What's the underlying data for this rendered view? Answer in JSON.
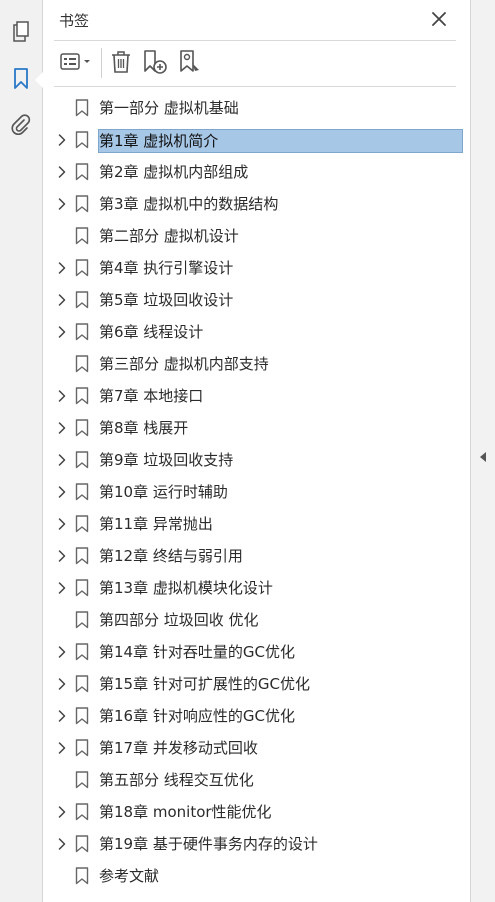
{
  "panel": {
    "title": "书签"
  },
  "rail": {
    "items": [
      {
        "icon": "pages-icon"
      },
      {
        "icon": "bookmark-icon",
        "active": true
      },
      {
        "icon": "attachment-icon"
      }
    ]
  },
  "toolbar": {
    "options_icon": "list-options-icon",
    "delete_icon": "trash-icon",
    "new_icon": "new-bookmark-icon",
    "edit_icon": "bookmark-edit-icon"
  },
  "bookmarks": [
    {
      "label": "第一部分 虚拟机基础",
      "expandable": false,
      "selected": false
    },
    {
      "label": "第1章 虚拟机简介",
      "expandable": true,
      "selected": true
    },
    {
      "label": "第2章 虚拟机内部组成",
      "expandable": true,
      "selected": false
    },
    {
      "label": "第3章 虚拟机中的数据结构",
      "expandable": true,
      "selected": false
    },
    {
      "label": "第二部分 虚拟机设计",
      "expandable": false,
      "selected": false
    },
    {
      "label": "第4章 执行引擎设计",
      "expandable": true,
      "selected": false
    },
    {
      "label": "第5章 垃圾回收设计",
      "expandable": true,
      "selected": false
    },
    {
      "label": "第6章 线程设计",
      "expandable": true,
      "selected": false
    },
    {
      "label": "第三部分 虚拟机内部支持",
      "expandable": false,
      "selected": false
    },
    {
      "label": "第7章 本地接口",
      "expandable": true,
      "selected": false
    },
    {
      "label": "第8章 栈展开",
      "expandable": true,
      "selected": false
    },
    {
      "label": "第9章 垃圾回收支持",
      "expandable": true,
      "selected": false
    },
    {
      "label": "第10章 运行时辅助",
      "expandable": true,
      "selected": false
    },
    {
      "label": "第11章 异常抛出",
      "expandable": true,
      "selected": false
    },
    {
      "label": "第12章 终结与弱引用",
      "expandable": true,
      "selected": false
    },
    {
      "label": "第13章 虚拟机模块化设计",
      "expandable": true,
      "selected": false
    },
    {
      "label": "第四部分 垃圾回收 优化",
      "expandable": false,
      "selected": false
    },
    {
      "label": "第14章 针对吞吐量的GC优化",
      "expandable": true,
      "selected": false
    },
    {
      "label": "第15章 针对可扩展性的GC优化",
      "expandable": true,
      "selected": false
    },
    {
      "label": "第16章 针对响应性的GC优化",
      "expandable": true,
      "selected": false
    },
    {
      "label": "第17章 并发移动式回收",
      "expandable": true,
      "selected": false
    },
    {
      "label": "第五部分 线程交互优化",
      "expandable": false,
      "selected": false
    },
    {
      "label": "第18章 monitor性能优化",
      "expandable": true,
      "selected": false
    },
    {
      "label": "第19章 基于硬件事务内存的设计",
      "expandable": true,
      "selected": false
    },
    {
      "label": "参考文献",
      "expandable": false,
      "selected": false
    }
  ],
  "colors": {
    "selection_fill": "#a7c7e6",
    "selection_border": "#7ea6cf",
    "rail_active": "#2a78c6",
    "icon_gray": "#555555"
  }
}
